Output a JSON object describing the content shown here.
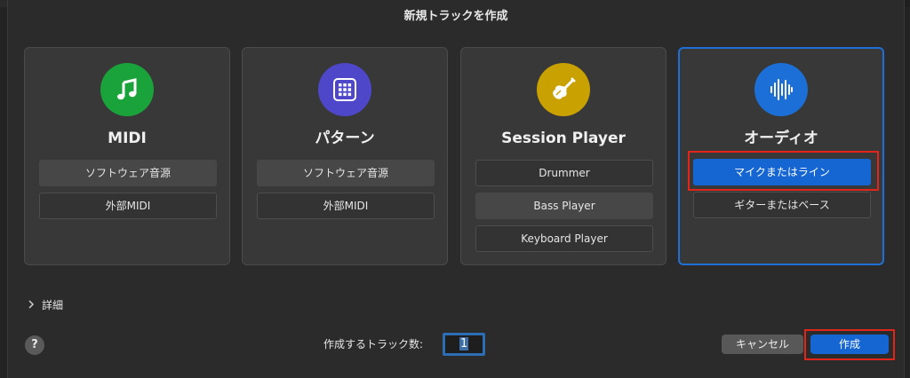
{
  "dialog": {
    "title": "新規トラックを作成"
  },
  "cards": [
    {
      "title": "MIDI",
      "icon": "music-note-icon",
      "icon_color": "#1aa33a",
      "options": [
        "ソフトウェア音源",
        "外部MIDI"
      ]
    },
    {
      "title": "パターン",
      "icon": "grid-pad-icon",
      "icon_color": "#4e47c9",
      "options": [
        "ソフトウェア音源",
        "外部MIDI"
      ]
    },
    {
      "title": "Session Player",
      "icon": "guitar-icon",
      "icon_color": "#c9a100",
      "options": [
        "Drummer",
        "Bass Player",
        "Keyboard Player"
      ]
    },
    {
      "title": "オーディオ",
      "icon": "waveform-icon",
      "icon_color": "#1b6fd6",
      "options": [
        "マイクまたはライン",
        "ギターまたはベース"
      ],
      "selected": true,
      "selected_option": "マイクまたはライン"
    }
  ],
  "details": {
    "label": "詳細",
    "chevron": "chevron-right-icon"
  },
  "help": {
    "label": "?"
  },
  "track_count": {
    "label": "作成するトラック数:",
    "value": "1"
  },
  "buttons": {
    "cancel": "キャンセル",
    "create": "作成"
  },
  "colors": {
    "accent": "#1566d2",
    "highlight_annotation": "#e1251b"
  }
}
